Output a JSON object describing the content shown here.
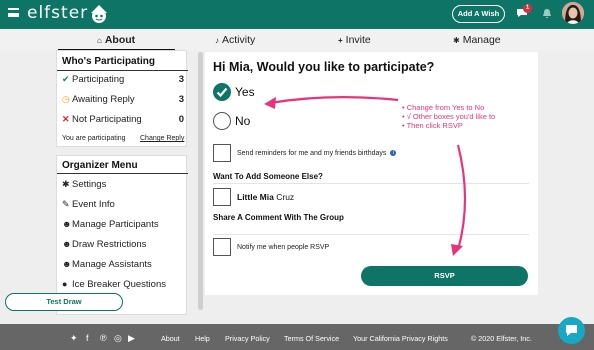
{
  "header": {
    "logo": "elfster",
    "add_wish": "Add A Wish",
    "chat_badge": "1"
  },
  "tabs": [
    {
      "label": "About",
      "icon": "home-icon"
    },
    {
      "label": "Activity",
      "icon": "bell-icon"
    },
    {
      "label": "Invite",
      "icon": "plus-icon"
    },
    {
      "label": "Manage",
      "icon": "gear-icon"
    }
  ],
  "participating": {
    "title": "Who's Participating",
    "rows": [
      {
        "label": "Participating",
        "count": "3",
        "icon": "check-icon",
        "color": "#12805c"
      },
      {
        "label": "Awaiting Reply",
        "count": "3",
        "icon": "clock-icon",
        "color": "#f0a020"
      },
      {
        "label": "Not Participating",
        "count": "0",
        "icon": "x-icon",
        "color": "#d8232a"
      }
    ],
    "status": "You are participating",
    "change": "Change Reply"
  },
  "organizer": {
    "title": "Organizer Menu",
    "items": [
      {
        "label": "Settings",
        "icon": "gear-icon"
      },
      {
        "label": "Event Info",
        "icon": "pencil-icon"
      },
      {
        "label": "Manage Participants",
        "icon": "users-icon"
      },
      {
        "label": "Draw Restrictions",
        "icon": "user-x-icon"
      },
      {
        "label": "Manage Assistants",
        "icon": "users-icon"
      },
      {
        "label": "Ice Breaker Questions",
        "icon": "comment-icon"
      }
    ],
    "test_draw": "Test Draw"
  },
  "main": {
    "question": "Hi Mia, Would you like to participate?",
    "yes": "Yes",
    "no": "No",
    "reminder": "Send reminders for me and my friends birthdays",
    "add_heading": "Want To Add Someone Else?",
    "person_first": "Little Mia",
    "person_last": "Cruz",
    "comment_heading": "Share A Comment With The Group",
    "notify": "Notify me when people RSVP",
    "rsvp": "RSVP"
  },
  "annotation": [
    "Change from Yes to No",
    "√ Other boxes you'd like to",
    "Then click RSVP"
  ],
  "footer": {
    "links": [
      "About",
      "Help",
      "Privacy Policy",
      "Terms Of Service",
      "Your California Privacy Rights"
    ],
    "copyright": "© 2020 Elfster, Inc.",
    "social": [
      "twitter-icon",
      "facebook-icon",
      "pinterest-icon",
      "instagram-icon",
      "youtube-icon"
    ]
  },
  "colors": {
    "brand": "#0d7466",
    "annotation": "#e8337a",
    "footer": "#666666"
  }
}
